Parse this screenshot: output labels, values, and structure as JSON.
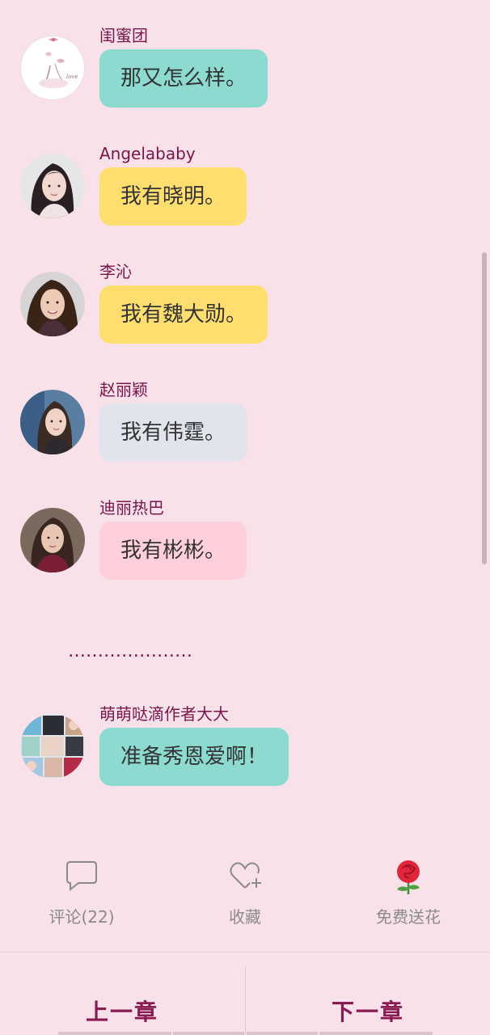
{
  "messages": [
    {
      "sender": "闺蜜团",
      "text": "那又怎么样。",
      "bubble_color": "#8ddad0",
      "avatar": "flower-logo-avatar"
    },
    {
      "sender": "Angelababy",
      "text": "我有晓明。",
      "bubble_color": "#fede6f",
      "avatar": "woman-portrait-avatar"
    },
    {
      "sender": "李沁",
      "text": "我有魏大勋。",
      "bubble_color": "#fede6f",
      "avatar": "woman-portrait-avatar"
    },
    {
      "sender": "赵丽颖",
      "text": "我有伟霆。",
      "bubble_color": "#e1e4ec",
      "avatar": "woman-portrait-avatar"
    },
    {
      "sender": "迪丽热巴",
      "text": "我有彬彬。",
      "bubble_color": "#ffd0dc",
      "avatar": "woman-portrait-avatar"
    }
  ],
  "ellipsis": "…………………",
  "final_message": {
    "sender": "萌萌哒滴作者大大",
    "text": "准备秀恩爱啊！",
    "bubble_color": "#8ddad0",
    "avatar": "collage-avatar"
  },
  "actions": [
    {
      "label": "评论(22)",
      "icon": "comment-icon"
    },
    {
      "label": "收藏",
      "icon": "heart-plus-icon"
    },
    {
      "label": "免费送花",
      "icon": "rose-icon"
    }
  ],
  "nav": {
    "prev_label": "上一章",
    "next_label": "下一章"
  },
  "colors": {
    "background": "#f9e1ea",
    "name_color": "#7a1449",
    "chapter_color": "#8a1a52",
    "action_label_color": "#8a8a8a"
  }
}
